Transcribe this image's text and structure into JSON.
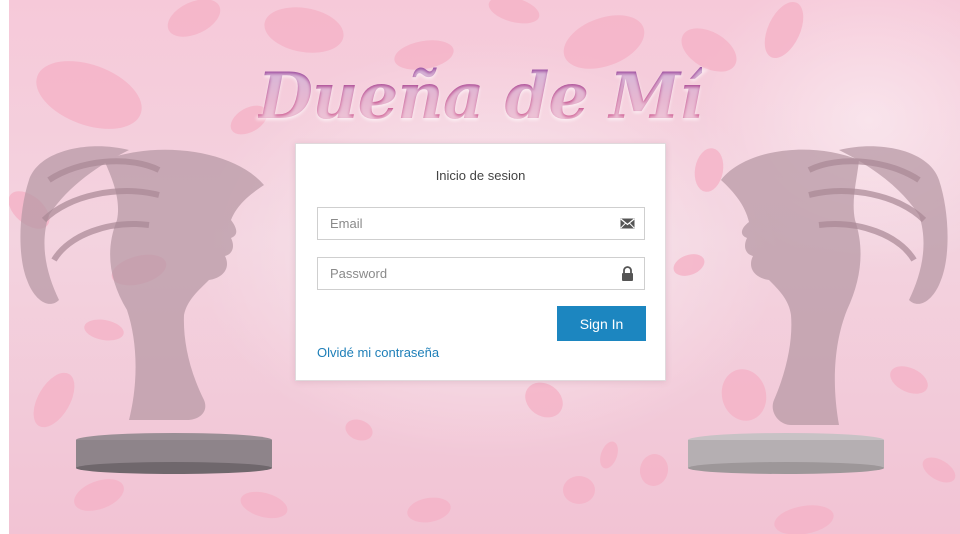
{
  "brand": {
    "logo_text": "Dueña de Mí"
  },
  "login": {
    "title": "Inicio de sesion",
    "email": {
      "placeholder": "Email",
      "value": "",
      "icon": "envelope-icon"
    },
    "password": {
      "placeholder": "Password",
      "value": "",
      "icon": "lock-icon"
    },
    "submit_label": "Sign In",
    "forgot_label": "Olvidé mi contraseña"
  },
  "colors": {
    "primary_button": "#1c86c0",
    "link": "#1e7fb8",
    "background": "#f4d4e0",
    "logo": "#c24d8c"
  }
}
